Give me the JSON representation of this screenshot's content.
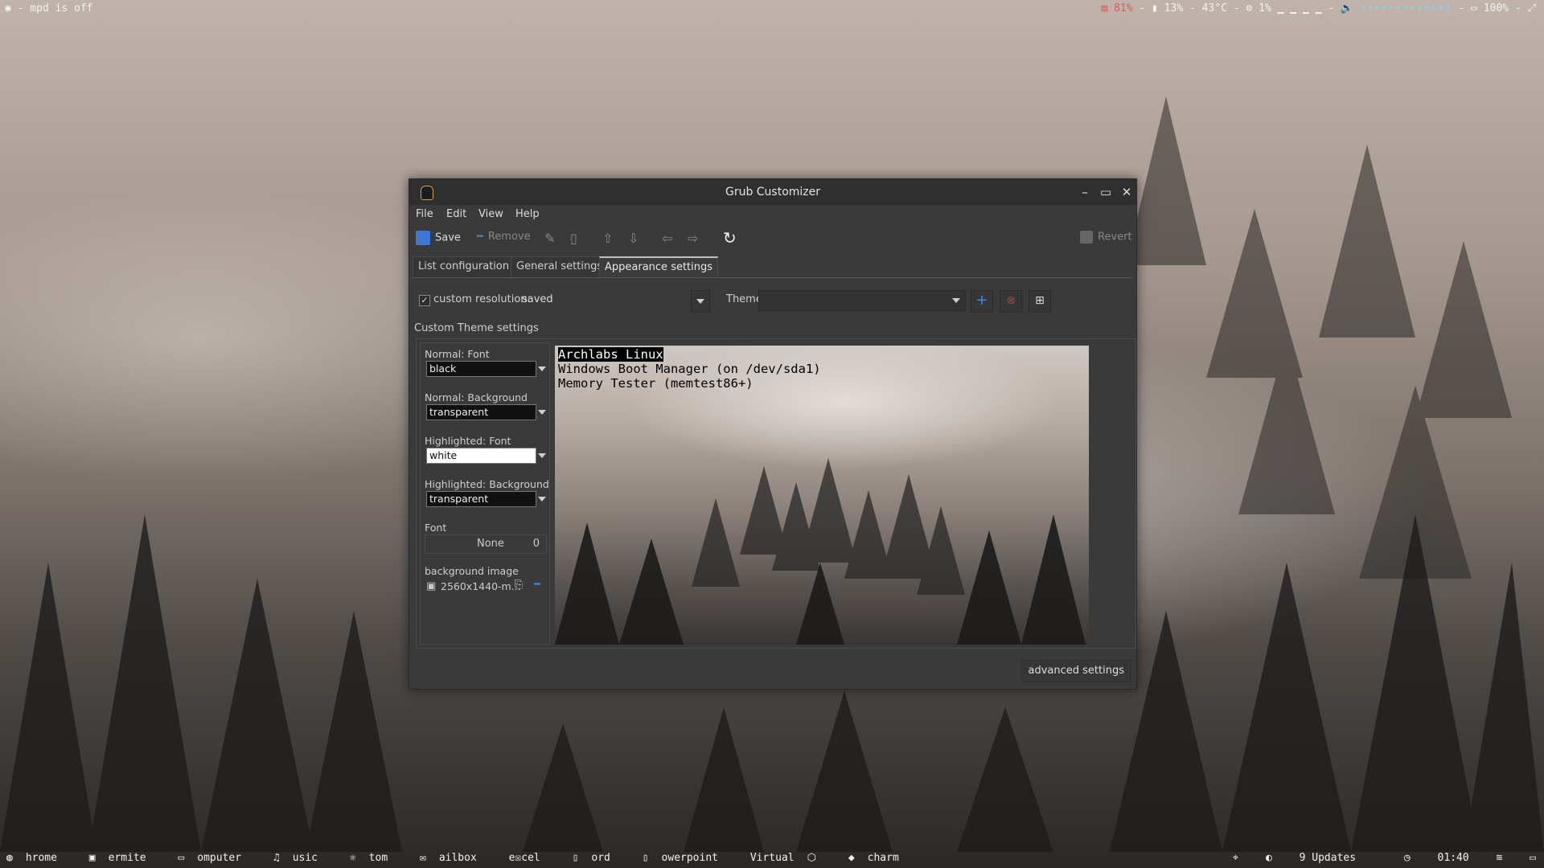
{
  "topbar": {
    "left": "- mpd is off",
    "ram": "81%",
    "disk": "13%",
    "temp": "43°C",
    "cpu": "1%",
    "volume_bar": "••••••••••••|",
    "battery": "100%"
  },
  "taskbar": {
    "apps": [
      "hrome",
      "ermite",
      "omputer",
      "usic",
      "tom",
      "ailbox",
      "e☒cel",
      "ord",
      "owerpoint",
      "Virtual",
      "charm"
    ],
    "updates": "9 Updates",
    "clock": "01:40"
  },
  "window": {
    "title": "Grub Customizer",
    "menu": [
      "File",
      "Edit",
      "View",
      "Help"
    ],
    "toolbar": {
      "save": "Save",
      "remove": "Remove",
      "revert": "Revert"
    },
    "tabs": [
      "List configuration",
      "General settings",
      "Appearance settings"
    ],
    "custom_resolution_label": "custom resolution:",
    "custom_resolution_value": "saved",
    "theme_label": "Theme:",
    "section_title": "Custom Theme settings",
    "normal_font_label": "Normal: Font",
    "normal_font_value": "black",
    "normal_bg_label": "Normal: Background",
    "normal_bg_value": "transparent",
    "hl_font_label": "Highlighted: Font",
    "hl_font_value": "white",
    "hl_bg_label": "Highlighted: Background",
    "hl_bg_value": "transparent",
    "font_label": "Font",
    "font_name": "None",
    "font_size": "0",
    "bg_image_label": "background image",
    "bg_image_value": "2560x1440-m...",
    "preview_entries": [
      "Archlabs Linux",
      "Windows Boot Manager (on /dev/sda1)",
      "Memory Tester (memtest86+)"
    ],
    "advanced": "advanced settings"
  },
  "colors": {
    "accent": "#3d78d8",
    "highlight_bg": "#000000",
    "normal_bg": "#111111"
  }
}
